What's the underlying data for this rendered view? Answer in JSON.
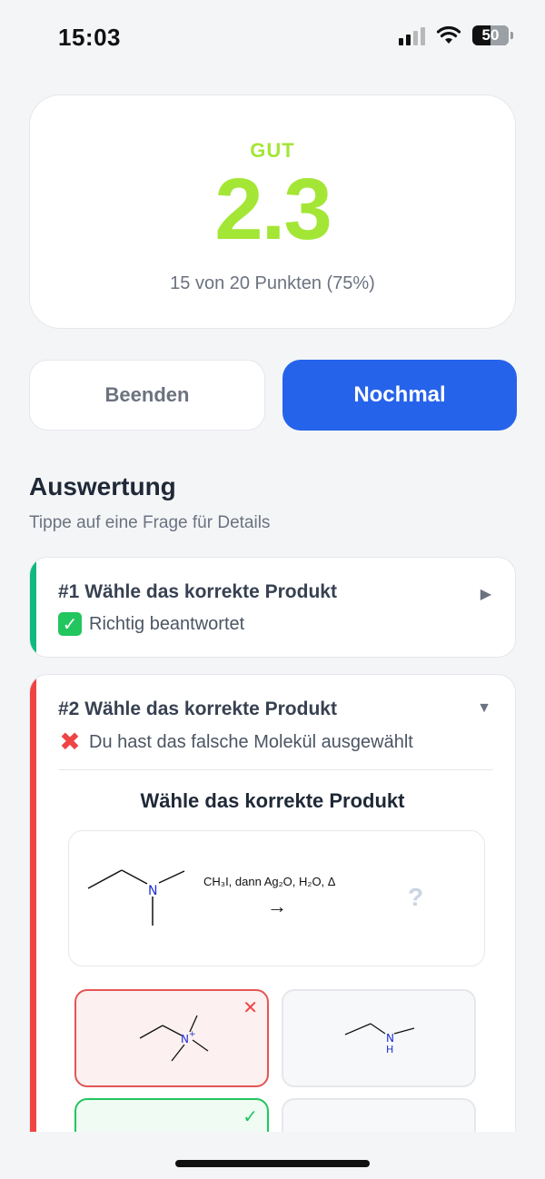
{
  "status_bar": {
    "time": "15:03",
    "battery": "50"
  },
  "result": {
    "grade_label": "GUT",
    "grade_value": "2.3",
    "points_text": "15 von 20 Punkten (75%)",
    "accent_color": "#a3e635"
  },
  "actions": {
    "end_label": "Beenden",
    "retry_label": "Nochmal"
  },
  "review": {
    "title": "Auswertung",
    "subtitle": "Tippe auf eine Frage für Details",
    "questions": [
      {
        "title": "#1 Wähle das korrekte Produkt",
        "status": "Richtig beantwortet",
        "status_icon": "check-emoji",
        "result_color": "#10b981",
        "expanded": false
      },
      {
        "title": "#2 Wähle das korrekte Produkt",
        "status": "Du hast das falsche Molekül ausgewählt",
        "status_icon": "cross-emoji",
        "result_color": "#ef4444",
        "expanded": true,
        "detail": {
          "prompt": "Wähle das korrekte Produkt",
          "reaction": {
            "reagents": "CH₃I, dann Ag₂O, H₂O, Δ",
            "unknown_product": "?"
          },
          "options": [
            {
              "state": "selected-wrong",
              "mark": "✕",
              "atom_label": "N",
              "charge": "+"
            },
            {
              "state": "neutral",
              "atom_label": "N",
              "h_label": "H"
            },
            {
              "state": "correct",
              "mark": "✓"
            },
            {
              "state": "neutral"
            }
          ]
        }
      }
    ]
  }
}
